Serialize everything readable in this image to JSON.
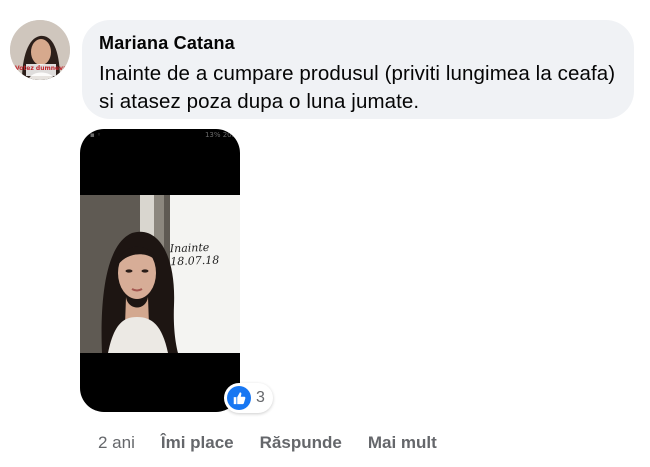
{
  "comment": {
    "author": "Mariana Catana",
    "text": "Inainte de a cumpare produsul (priviti lungimea la ceafa) si atasez poza dupa o luna jumate.",
    "avatar_badge_text": "Votez dumneva",
    "photo": {
      "status_right": "13% 20:",
      "caption": "Inainte 18.07.18"
    },
    "reaction": {
      "icon": "thumbs-up-icon",
      "count": "3"
    },
    "timestamp": "2 ani",
    "actions": {
      "like": "Îmi place",
      "reply": "Răspunde",
      "more": "Mai mult"
    }
  },
  "colors": {
    "bubble": "#f0f2f5",
    "like_blue": "#1877f2",
    "secondary_text": "#65676b"
  }
}
